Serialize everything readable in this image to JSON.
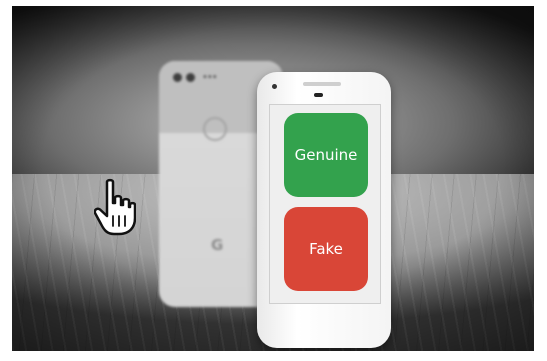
{
  "buttons": {
    "genuine_label": "Genuine",
    "fake_label": "Fake"
  },
  "back_phone": {
    "logo": "G"
  },
  "colors": {
    "genuine": "#33a24d",
    "fake": "#d94637"
  },
  "icons": {
    "cursor": "hand-pointer-icon"
  }
}
